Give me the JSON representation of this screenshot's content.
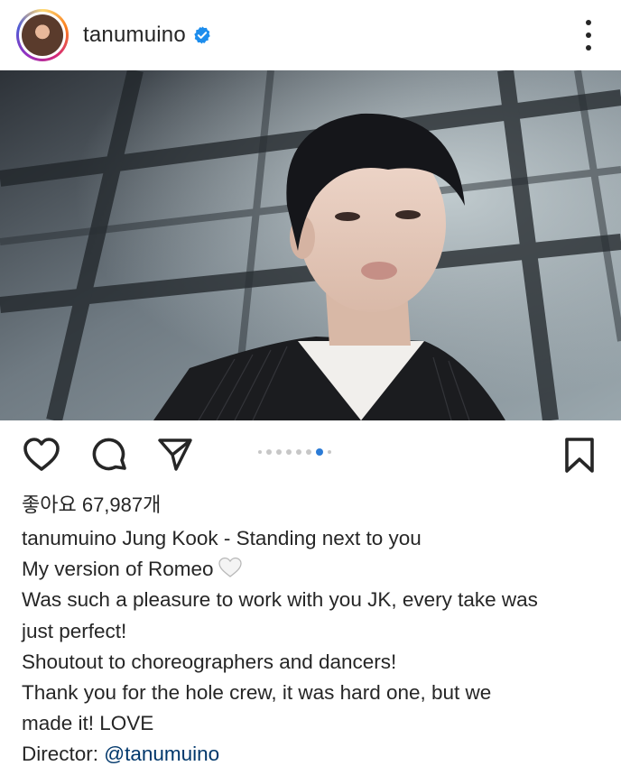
{
  "post": {
    "username": "tanumuino",
    "verified": true,
    "photo_description_icon": "photo",
    "carousel": {
      "total": 8,
      "active_index": 6
    },
    "likes_text": "좋아요 67,987개",
    "caption": {
      "author": "tanumuino",
      "line1_text": " Jung Kook - Standing next to you",
      "line2_text": "My version of Romeo",
      "line2_emoji": "white-heart-emoji",
      "line3_text": "Was such a pleasure to work with you JK, every take was",
      "line4_text": "just perfect!",
      "line5_text": "Shoutout to choreographers and dancers!",
      "line6_text": "Thank you for the hole crew, it was hard one, but we",
      "line7_text": "made it! LOVE",
      "line8_prefix": "Director: ",
      "line8_mention": "@tanumuino"
    }
  },
  "colors": {
    "text": "#262626",
    "mention": "#00376b",
    "carousel_active": "#2b7bd6",
    "verified_badge": "#1d8ded"
  },
  "icons": {
    "like": "heart-outline-icon",
    "comment": "comment-bubble-icon",
    "share": "paper-plane-icon",
    "save": "bookmark-icon",
    "more": "more-vertical-icon"
  }
}
